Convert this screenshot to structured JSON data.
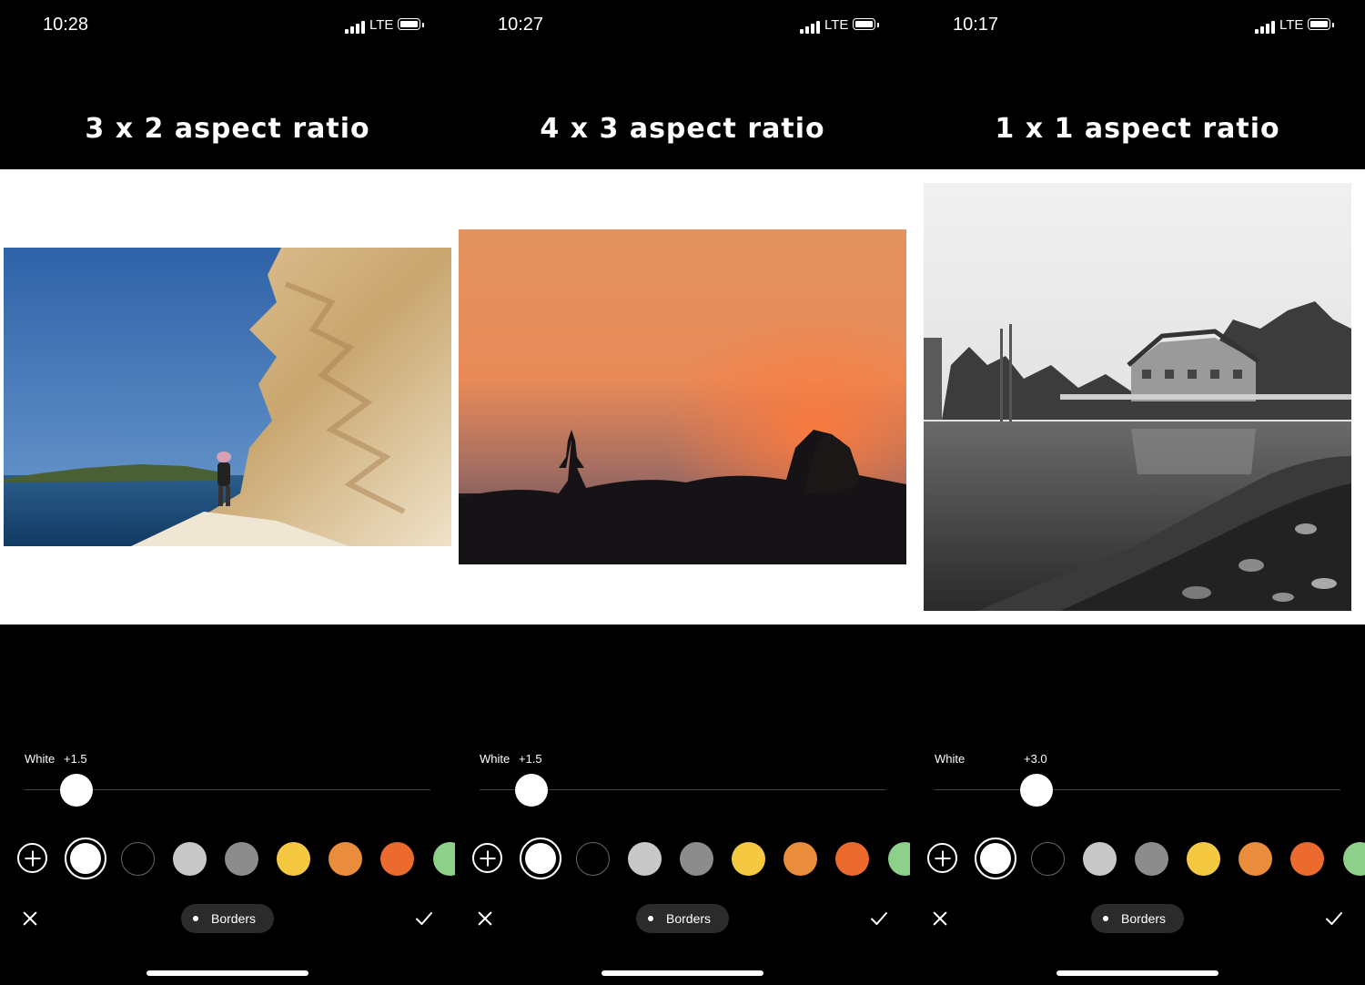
{
  "colors": {
    "background": "#000000",
    "canvas": "#ffffff",
    "thumb": "#ffffff",
    "pill": "#2b2b2b"
  },
  "swatch_colors": [
    "#000000",
    "#c8c8c8",
    "#8c8c8c",
    "#f5c842",
    "#e98c3c",
    "#ec6a2e",
    "#8cd08a"
  ],
  "icons": {
    "add": "plus-circle-icon",
    "close": "close-icon",
    "confirm": "checkmark-icon",
    "signal": "cellular-signal-icon",
    "battery": "battery-icon"
  },
  "panels": [
    {
      "status": {
        "time": "10:28",
        "network": "LTE"
      },
      "title": "3 x 2 aspect ratio",
      "photo_scene": "coastal rock cliff with hiker",
      "slider": {
        "label": "White",
        "value": "+1.5",
        "position_fraction": 0.127
      },
      "tool": {
        "label": "Borders"
      }
    },
    {
      "status": {
        "time": "10:27",
        "network": "LTE"
      },
      "title": "4 x 3 aspect ratio",
      "photo_scene": "orange sunset with temple silhouette",
      "slider": {
        "label": "White",
        "value": "+1.5",
        "position_fraction": 0.127
      },
      "tool": {
        "label": "Borders"
      }
    },
    {
      "status": {
        "time": "10:17",
        "network": "LTE"
      },
      "title": "1 x 1 aspect ratio",
      "photo_scene": "black and white harbor boathouse",
      "slider": {
        "label": "White",
        "value": "+3.0",
        "position_fraction": 0.25
      },
      "tool": {
        "label": "Borders"
      }
    }
  ]
}
